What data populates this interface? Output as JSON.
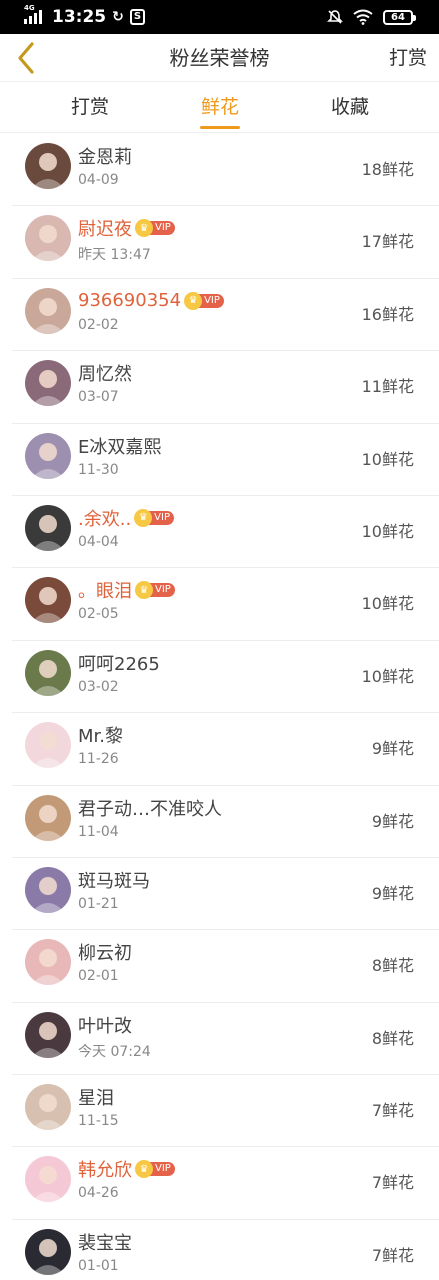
{
  "status_bar": {
    "network": "4G",
    "time": "13:25",
    "battery": "64"
  },
  "header": {
    "title": "粉丝荣誉榜",
    "right_action": "打赏"
  },
  "tabs": [
    {
      "label": "打赏",
      "active": false
    },
    {
      "label": "鲜花",
      "active": true
    },
    {
      "label": "收藏",
      "active": false
    }
  ],
  "vip_label": "VIP",
  "fans": [
    {
      "name": "金恩莉",
      "date": "04-09",
      "count": "18鲜花",
      "vip": false,
      "avatar_color": "#6b4a3e"
    },
    {
      "name": "尉迟夜",
      "date": "昨天 13:47",
      "count": "17鲜花",
      "vip": true,
      "avatar_color": "#d8b8b0"
    },
    {
      "name": "936690354",
      "date": "02-02",
      "count": "16鲜花",
      "vip": true,
      "avatar_color": "#c9a89a"
    },
    {
      "name": "周忆然",
      "date": "03-07",
      "count": "11鲜花",
      "vip": false,
      "avatar_color": "#8a6a78"
    },
    {
      "name": "E冰双嘉熙",
      "date": "11-30",
      "count": "10鲜花",
      "vip": false,
      "avatar_color": "#9c8fb0"
    },
    {
      "name": ".余欢..",
      "date": "04-04",
      "count": "10鲜花",
      "vip": true,
      "avatar_color": "#3a3a3a"
    },
    {
      "name": "。眼泪",
      "date": "02-05",
      "count": "10鲜花",
      "vip": true,
      "avatar_color": "#7a4a3a"
    },
    {
      "name": "呵呵2265",
      "date": "03-02",
      "count": "10鲜花",
      "vip": false,
      "avatar_color": "#6a7a4a"
    },
    {
      "name": "Mr.黎",
      "date": "11-26",
      "count": "9鲜花",
      "vip": false,
      "avatar_color": "#f2d8dc"
    },
    {
      "name": "君子动…不准咬人",
      "date": "11-04",
      "count": "9鲜花",
      "vip": false,
      "avatar_color": "#c29a78"
    },
    {
      "name": "斑马斑马",
      "date": "01-21",
      "count": "9鲜花",
      "vip": false,
      "avatar_color": "#8a7aa8"
    },
    {
      "name": "柳云初",
      "date": "02-01",
      "count": "8鲜花",
      "vip": false,
      "avatar_color": "#e8b8b8"
    },
    {
      "name": "叶叶改",
      "date": "今天 07:24",
      "count": "8鲜花",
      "vip": false,
      "avatar_color": "#4a3a40"
    },
    {
      "name": "星泪",
      "date": "11-15",
      "count": "7鲜花",
      "vip": false,
      "avatar_color": "#d8c0b0"
    },
    {
      "name": "韩允欣",
      "date": "04-26",
      "count": "7鲜花",
      "vip": true,
      "avatar_color": "#f4c8d4"
    },
    {
      "name": "裴宝宝",
      "date": "01-01",
      "count": "7鲜花",
      "vip": false,
      "avatar_color": "#2a2a32"
    }
  ]
}
